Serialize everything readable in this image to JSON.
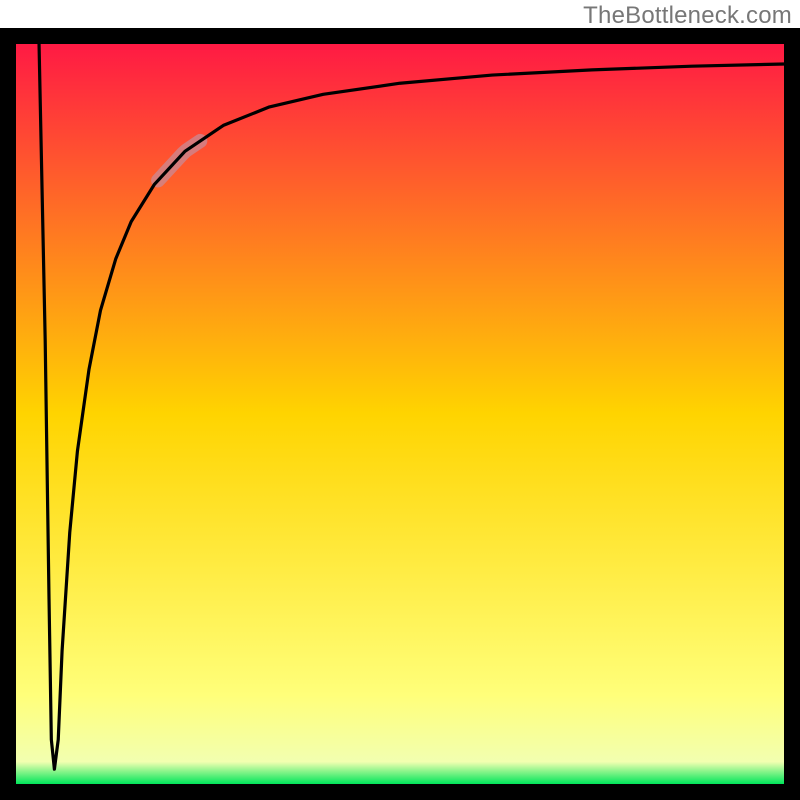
{
  "watermark": "TheBottleneck.com",
  "chart_data": {
    "type": "line",
    "title": "",
    "xlabel": "",
    "ylabel": "",
    "xlim": [
      0,
      100
    ],
    "ylim": [
      0,
      100
    ],
    "background_gradient": {
      "stops": [
        {
          "pos": 0.0,
          "color": "#ff1a44"
        },
        {
          "pos": 0.5,
          "color": "#ffd400"
        },
        {
          "pos": 0.88,
          "color": "#ffff7a"
        },
        {
          "pos": 0.97,
          "color": "#f2ffb0"
        },
        {
          "pos": 1.0,
          "color": "#00e65a"
        }
      ]
    },
    "series": [
      {
        "name": "bottleneck-curve",
        "x": [
          3.0,
          3.8,
          4.3,
          4.6,
          5.0,
          5.5,
          6.0,
          7.0,
          8.0,
          9.5,
          11.0,
          13.0,
          15.0,
          18.0,
          22.0,
          27.0,
          33.0,
          40.0,
          50.0,
          62.0,
          75.0,
          88.0,
          100.0
        ],
        "y": [
          100.0,
          60.0,
          25.0,
          6.0,
          2.0,
          6.0,
          18.0,
          34.0,
          45.0,
          56.0,
          64.0,
          71.0,
          76.0,
          81.0,
          85.5,
          89.0,
          91.5,
          93.2,
          94.7,
          95.8,
          96.5,
          97.0,
          97.3
        ]
      }
    ],
    "highlight_segment": {
      "x_start": 18.5,
      "x_end": 24.0,
      "color": "#c98a95",
      "width": 14
    },
    "frame_color": "#000000",
    "frame_width": 16
  }
}
